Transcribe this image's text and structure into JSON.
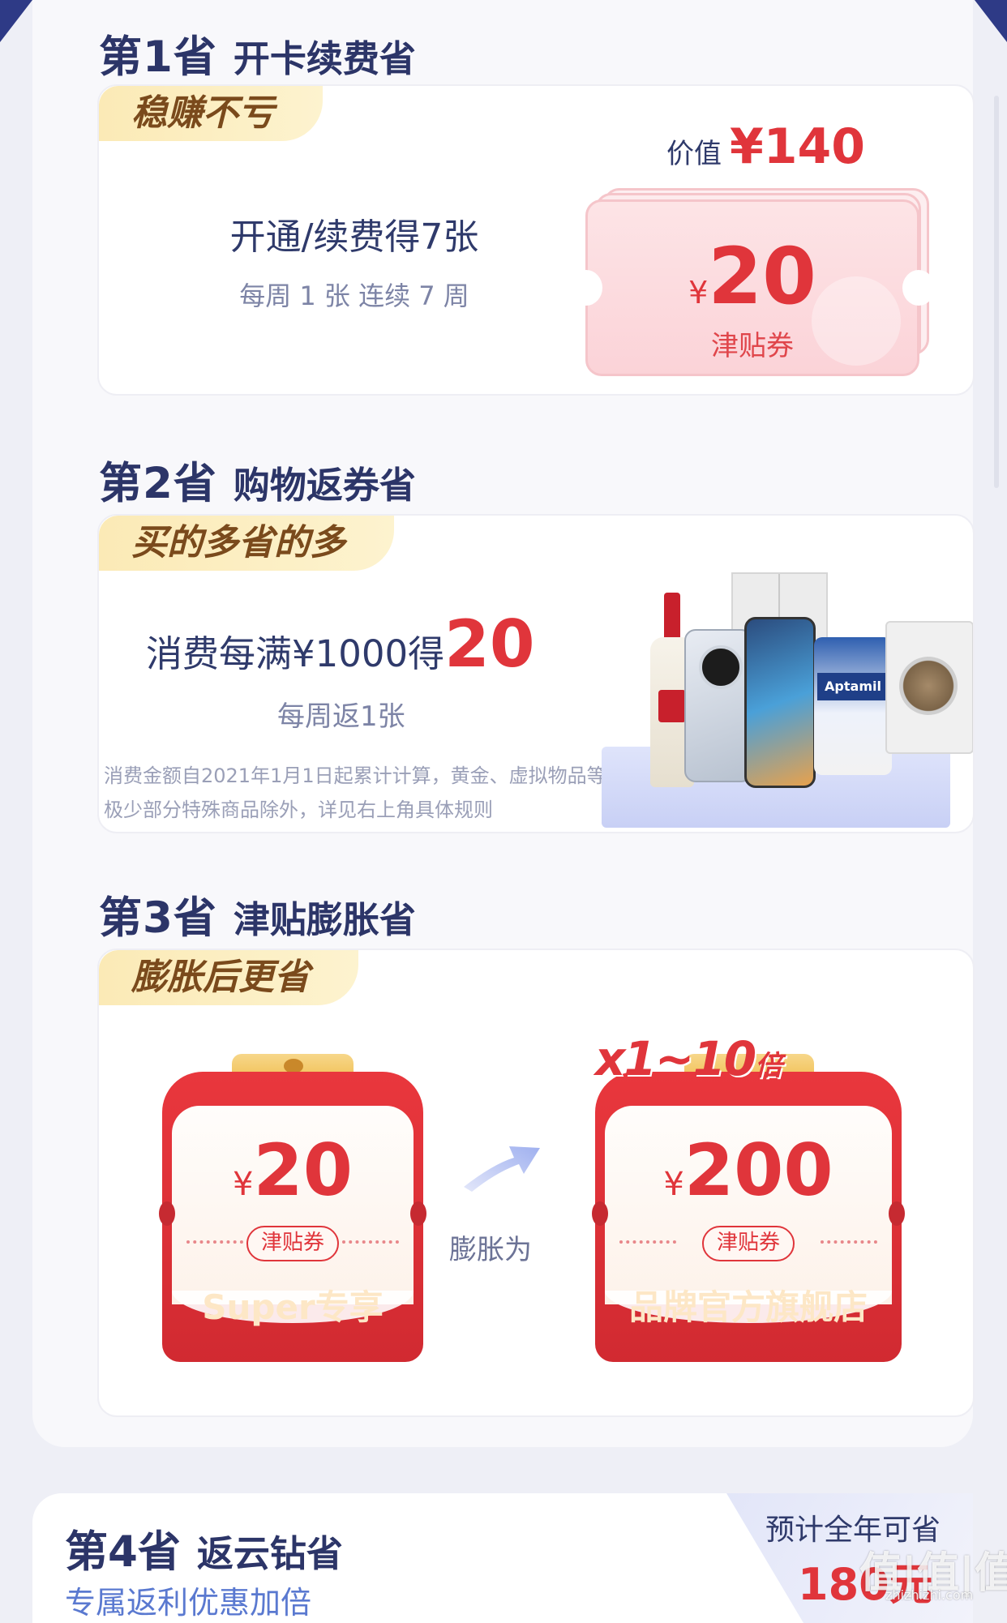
{
  "section1": {
    "num": "第1省",
    "title": "开卡续费省",
    "badge": "稳赚不亏",
    "main": "开通/续费得7张",
    "sub": "每周 1 张  连续 7 周",
    "value_label": "价值",
    "value_amount": "¥140",
    "ticket_currency": "¥",
    "ticket_amount": "20",
    "ticket_name": "津贴券"
  },
  "section2": {
    "num": "第2省",
    "title": "购物返券省",
    "badge": "买的多省的多",
    "main_text": "消费每满¥1000得",
    "main_big": "20",
    "sub": "每周返1张",
    "note": "消费金额自2021年1月1日起累计计算，黄金、虚拟物品等极少部分特殊商品除外，详见右上角具体规则",
    "product_tag": "Aptamil"
  },
  "section3": {
    "num": "第3省",
    "title": "津贴膨胀省",
    "badge": "膨胀后更省",
    "arrow_label": "膨胀为",
    "multiplier": "x1~10",
    "multiplier_suffix": "倍",
    "left_coupon": {
      "currency": "¥",
      "amount": "20",
      "tag": "津贴券",
      "footer": "Super专享"
    },
    "right_coupon": {
      "currency": "¥",
      "amount": "200",
      "tag": "津贴券",
      "footer": "品牌官方旗舰店"
    }
  },
  "section4": {
    "num": "第4省",
    "title": "返云钻省",
    "link": "专属返利优惠加倍",
    "estimate_label": "预计全年可省",
    "estimate_amount": "180元"
  },
  "watermark": {
    "main": "值|值|值",
    "sub": "zhizhizhi.com"
  },
  "colors": {
    "accent_red": "#e0353b",
    "navy": "#2c3568",
    "badge_yellow": "#fbeab6"
  }
}
